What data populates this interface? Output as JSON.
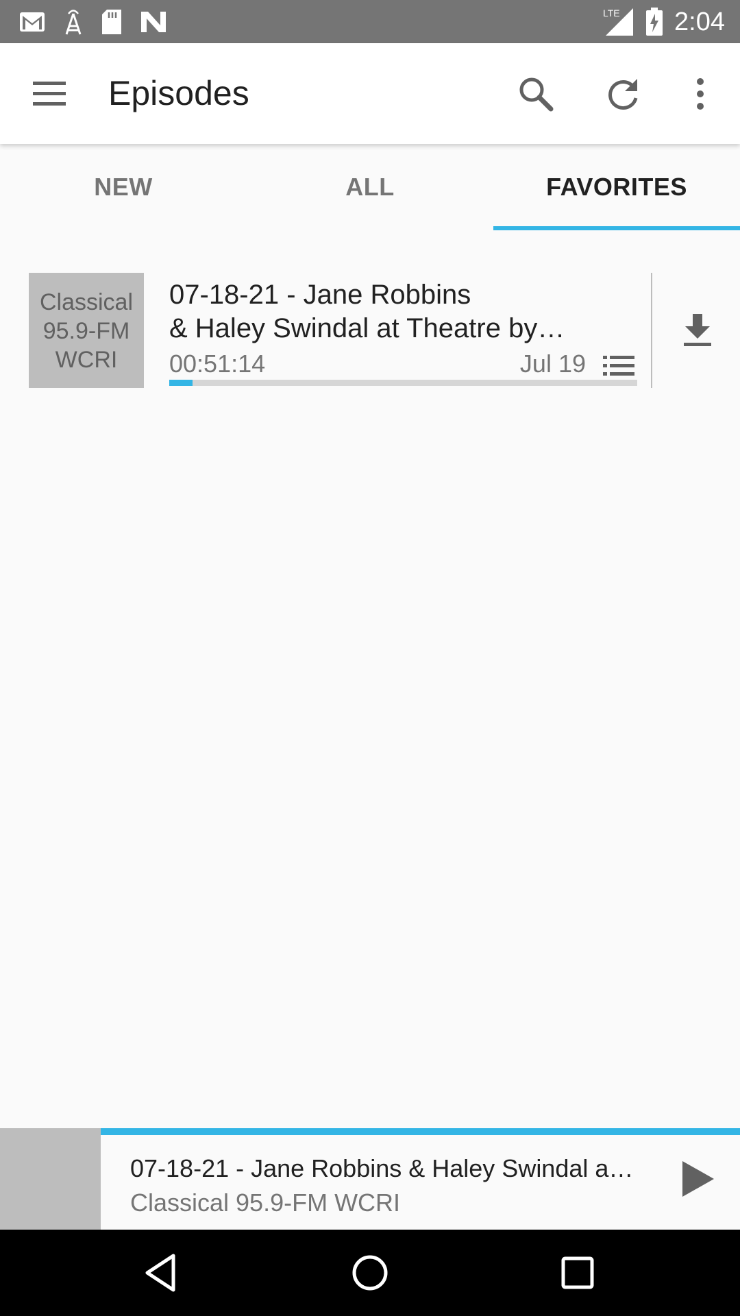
{
  "status_bar": {
    "time": "2:04",
    "network": "LTE",
    "icons": [
      "gmail-icon",
      "antenna-icon",
      "sd-card-icon",
      "n-icon",
      "signal-icon",
      "battery-charging-icon"
    ]
  },
  "app_bar": {
    "title": "Episodes",
    "icons": [
      "menu-icon",
      "search-icon",
      "refresh-icon",
      "more-vert-icon"
    ]
  },
  "tabs": [
    {
      "label": "NEW",
      "active": false
    },
    {
      "label": "ALL",
      "active": false
    },
    {
      "label": "FAVORITES",
      "active": true
    }
  ],
  "episodes": [
    {
      "thumbnail_text": "Classical\n95.9-FM\nWCRI",
      "title": "07-18-21  -  Jane Robbins\n& Haley Swindal  at Theatre by…",
      "duration": "00:51:14",
      "date": "Jul 19",
      "progress": 0.05,
      "icons": [
        "queue-list-icon",
        "download-icon"
      ]
    }
  ],
  "now_playing": {
    "title": "07-18-21  -  Jane Robbins & Haley Swindal  a…",
    "subtitle": "Classical 95.9-FM WCRI",
    "icon": "play-icon"
  },
  "colors": {
    "accent": "#33b5e5",
    "status_bar": "#757575",
    "thumbnail": "#bdbdbd"
  }
}
